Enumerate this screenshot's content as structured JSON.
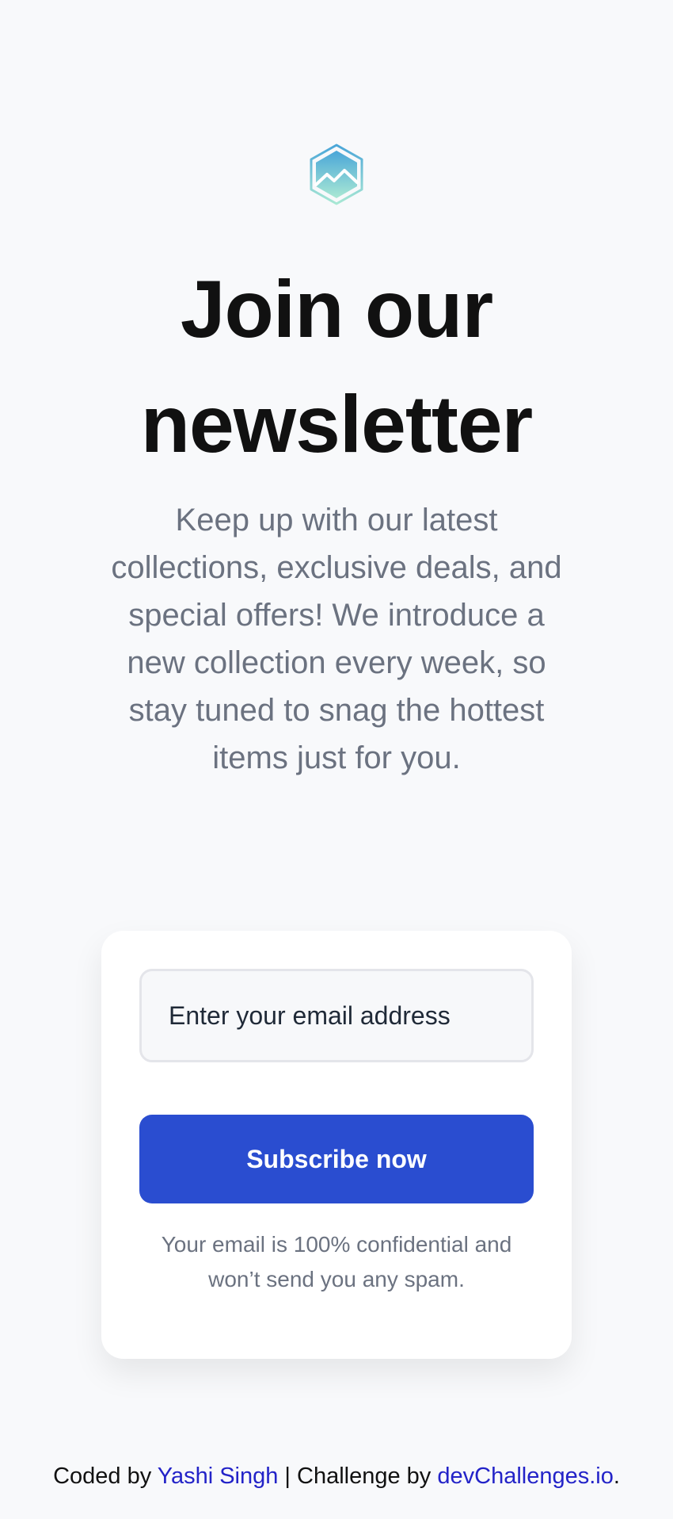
{
  "brand": {
    "logo_icon": "mountain-hexagon-icon",
    "colors": {
      "logo_top": "#4aa6d8",
      "logo_bottom": "#a9e8d4",
      "accent": "#2a4dd0",
      "link": "#2323c8"
    }
  },
  "hero": {
    "title_line_1": "Join our",
    "title_line_2": "newsletter",
    "description": "Keep up with our latest collections, exclusive deals, and special offers! We introduce a new collection every week, so stay tuned to snag the hottest items just for you."
  },
  "form": {
    "email_placeholder": "Enter your email address",
    "email_value": "",
    "subscribe_label": "Subscribe now",
    "privacy_note": "Your email is 100% confidential and won’t send you any spam."
  },
  "footer": {
    "coded_by_prefix": "Coded by ",
    "author_name": "Yashi Singh",
    "separator": " | Challenge by ",
    "challenge_site": "devChallenges.io",
    "end_punctuation": "."
  }
}
